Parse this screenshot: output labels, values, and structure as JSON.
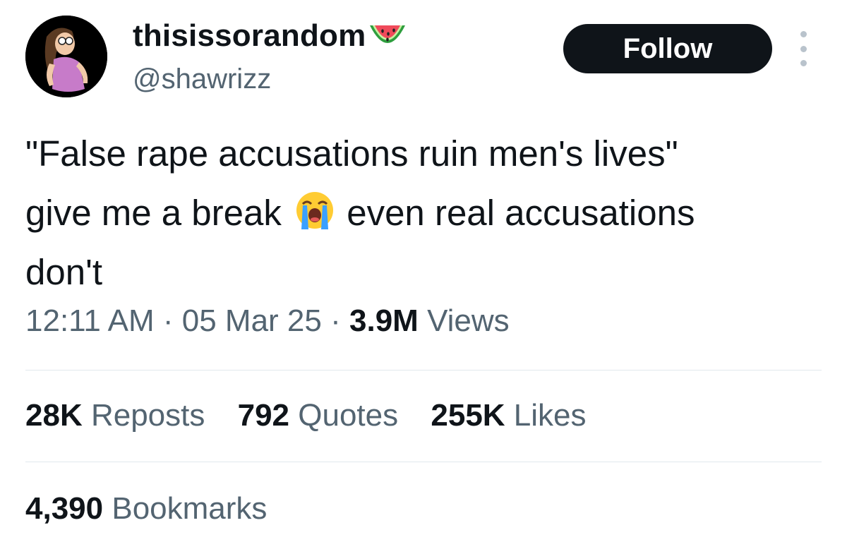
{
  "author": {
    "display_name": "thisissorandom",
    "name_emoji": "watermelon-icon",
    "handle": "@shawrizz"
  },
  "header": {
    "follow_label": "Follow",
    "more_icon": "more-options-icon"
  },
  "tweet": {
    "line1": "\"False rape accusations ruin men's lives\"",
    "line2_before_emoji": "give me a break",
    "emoji": "loudly-crying-face-icon",
    "line2_after_emoji": "even real accusations",
    "line3": "don't"
  },
  "meta": {
    "time": "12:11 AM",
    "separator": "·",
    "date": "05 Mar 25",
    "views_count": "3.9M",
    "views_label": "Views"
  },
  "stats": {
    "reposts_count": "28K",
    "reposts_label": "Reposts",
    "quotes_count": "792",
    "quotes_label": "Quotes",
    "likes_count": "255K",
    "likes_label": "Likes"
  },
  "bookmarks": {
    "count": "4,390",
    "label": "Bookmarks"
  },
  "colors": {
    "text_primary": "#0f1419",
    "text_secondary": "#536471",
    "button_bg": "#0f1419",
    "divider": "#e1e8ed"
  }
}
